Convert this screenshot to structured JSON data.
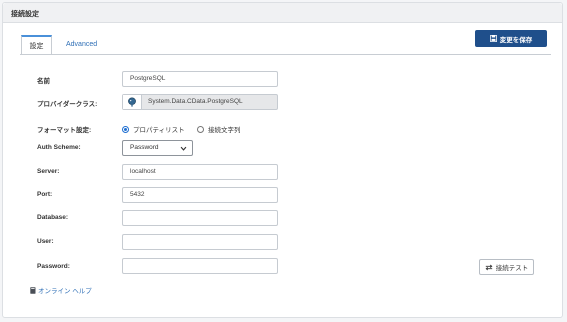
{
  "panel": {
    "title": "接続設定"
  },
  "tabs": [
    {
      "label": "設定",
      "active": true
    },
    {
      "label": "Advanced",
      "active": false
    }
  ],
  "toolbar": {
    "save_label": "変更を保存",
    "save_icon": "save-icon"
  },
  "form": {
    "name": {
      "label": "名前",
      "value": "PostgreSQL"
    },
    "provider": {
      "label": "プロバイダークラス:",
      "value": "System.Data.CData.PostgreSQL",
      "icon": "postgresql-elephant-icon"
    },
    "format": {
      "label": "フォーマット設定:",
      "options": [
        {
          "label": "プロパティリスト",
          "selected": true
        },
        {
          "label": "接続文字列",
          "selected": false
        }
      ]
    },
    "auth_scheme": {
      "label": "Auth Scheme:",
      "value": "Password"
    },
    "server": {
      "label": "Server:",
      "value": "localhost"
    },
    "port": {
      "label": "Port:",
      "value": "5432"
    },
    "database": {
      "label": "Database:",
      "value": ""
    },
    "user": {
      "label": "User:",
      "value": ""
    },
    "password": {
      "label": "Password:",
      "value": ""
    }
  },
  "test_button": {
    "label": "接続テスト",
    "icon": "swap-arrows-icon"
  },
  "help": {
    "label": "オンライン ヘルプ",
    "icon": "book-icon"
  },
  "colors": {
    "primary": "#1f4f8b",
    "link": "#2f6fb6",
    "radio": "#1f6fd1",
    "tab_accent": "#4a90d9"
  }
}
